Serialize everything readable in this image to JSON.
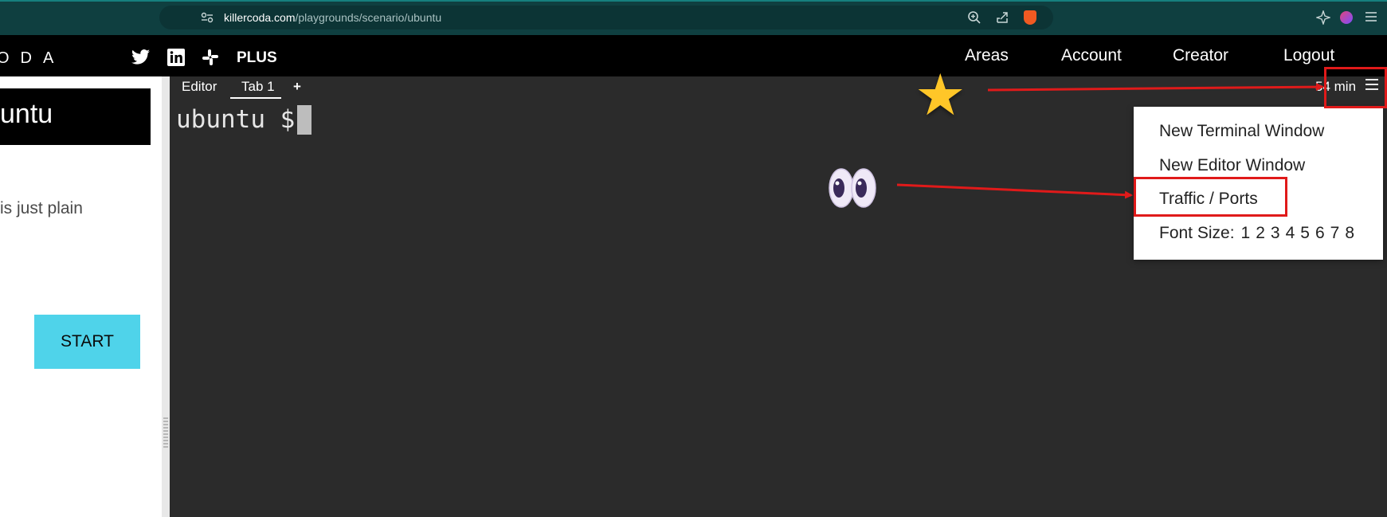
{
  "browser": {
    "url_domain": "killercoda.com",
    "url_path": "/playgrounds/scenario/ubuntu"
  },
  "site_nav": {
    "logo": "ODA",
    "plus_label": "PLUS",
    "social_icons": [
      "twitter-icon",
      "linkedin-icon",
      "slack-icon"
    ],
    "links": [
      "Areas",
      "Account",
      "Creator",
      "Logout"
    ]
  },
  "left_panel": {
    "title": "untu",
    "description": "is just plain",
    "start_label": "START"
  },
  "terminal": {
    "tabs": [
      "Editor",
      "Tab 1",
      "+"
    ],
    "active_tab": "Tab 1",
    "prompt": "ubuntu $",
    "timer": "54 min"
  },
  "menu": {
    "items": [
      "New Terminal Window",
      "New Editor Window",
      "Traffic / Ports"
    ],
    "font_size_label": "Font Size:",
    "font_sizes": [
      "1",
      "2",
      "3",
      "4",
      "5",
      "6",
      "7",
      "8"
    ]
  },
  "annotations": {
    "colors": {
      "arrow": "#e01a1a",
      "start_button": "#4fd3ea",
      "terminal_bg": "#2b2b2b"
    }
  }
}
